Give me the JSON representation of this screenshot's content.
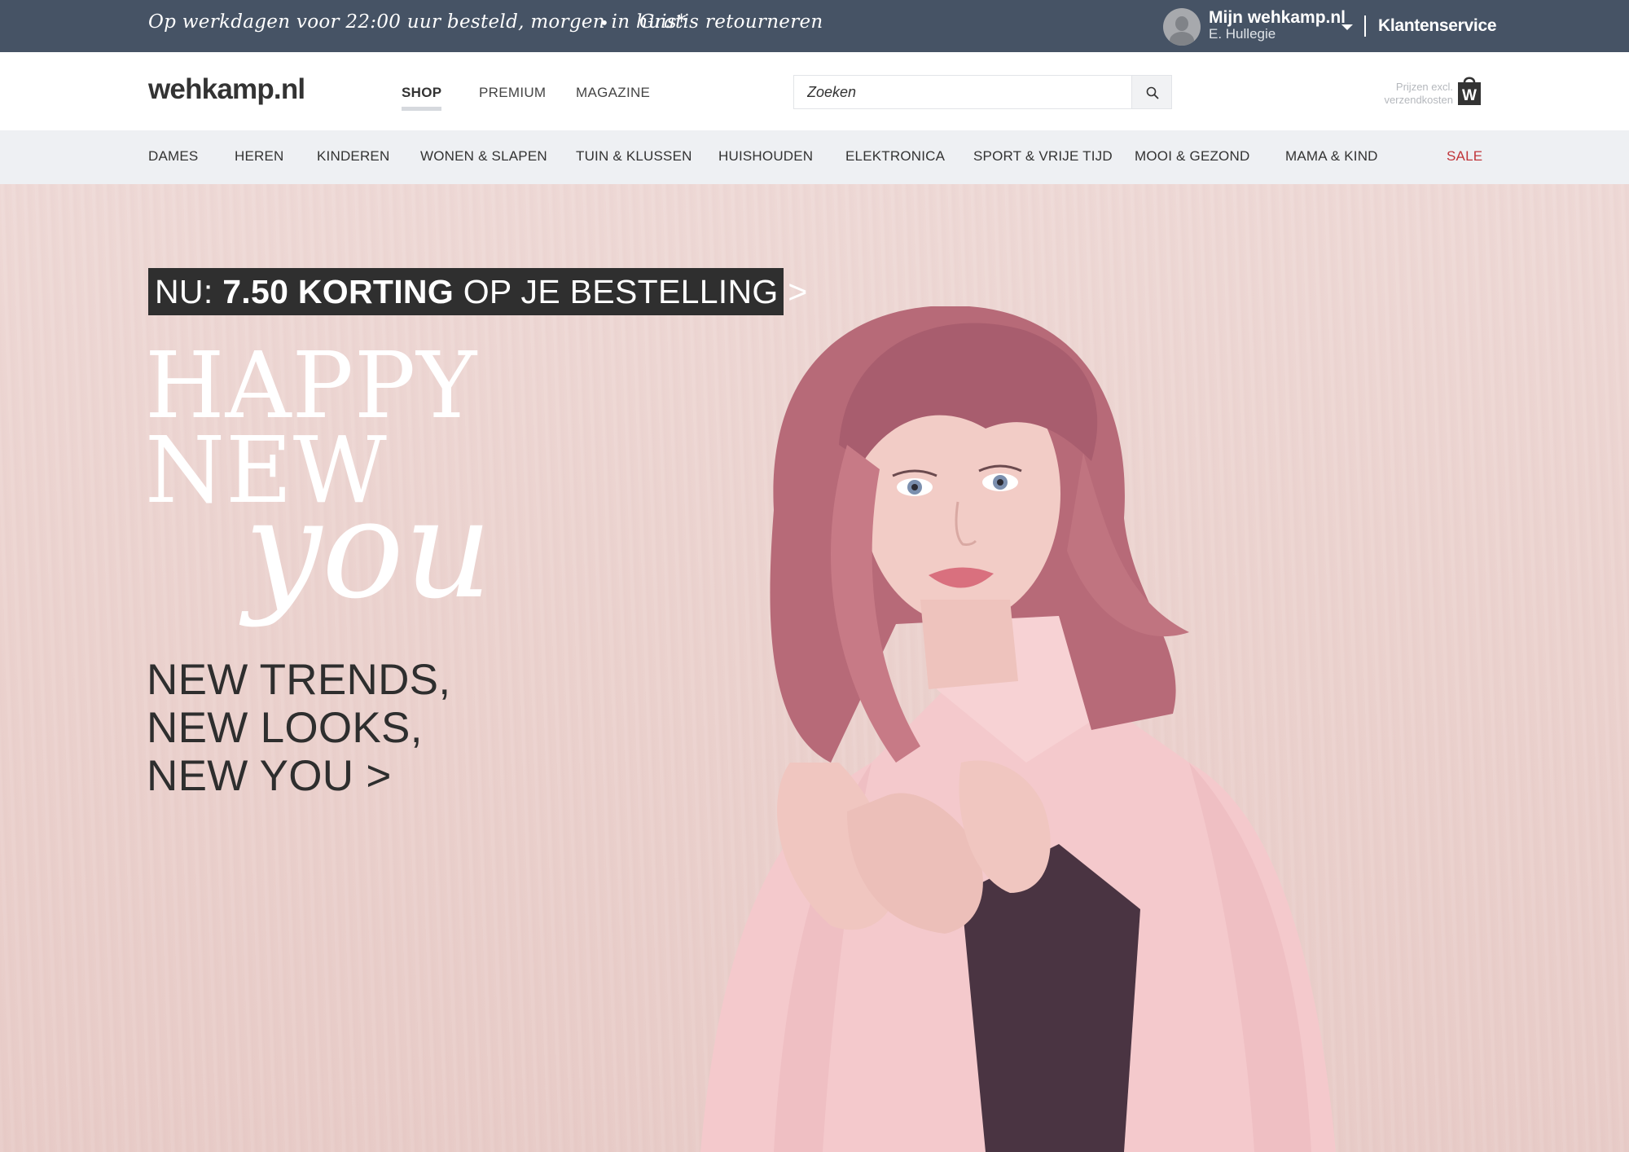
{
  "topbar": {
    "usp_delivery": "Op werkdagen voor 22:00 uur besteld, morgen in huis*",
    "usp_separator": "•",
    "usp_returns": "Gratis retourneren",
    "account_title": "Mijn wehkamp.nl",
    "account_user": "E. Hullegie",
    "customer_service": "Klantenservice"
  },
  "header": {
    "logo": "wehkamp.nl",
    "tabs": [
      {
        "label": "SHOP",
        "active": true
      },
      {
        "label": "PREMIUM",
        "active": false
      },
      {
        "label": "MAGAZINE",
        "active": false
      }
    ],
    "search": {
      "placeholder": "Zoeken"
    },
    "price_note": "Prijzen excl. verzendkosten",
    "bag_letter": "W"
  },
  "categories": [
    "DAMES",
    "HEREN",
    "KINDEREN",
    "WONEN & SLAPEN",
    "TUIN & KLUSSEN",
    "HUISHOUDEN",
    "ELEKTRONICA",
    "SPORT & VRIJE TIJD",
    "MOOI & GEZOND",
    "MAMA & KIND",
    "SALE"
  ],
  "hero": {
    "promo_prefix": "NU: ",
    "promo_bold": "7.50 KORTING",
    "promo_suffix": " OP JE BESTELLING >",
    "headline_1": "HAPPY",
    "headline_2": "NEW",
    "headline_3": "you",
    "tagline_1": "NEW TRENDS,",
    "tagline_2": "NEW LOOKS,",
    "tagline_3": "NEW YOU >"
  },
  "colors": {
    "topbar": "#465365",
    "category_bar": "#eef0f3",
    "sale": "#c0353a",
    "hero_bg": "#ebd2ce",
    "promo_bg": "#2f2f2f"
  }
}
